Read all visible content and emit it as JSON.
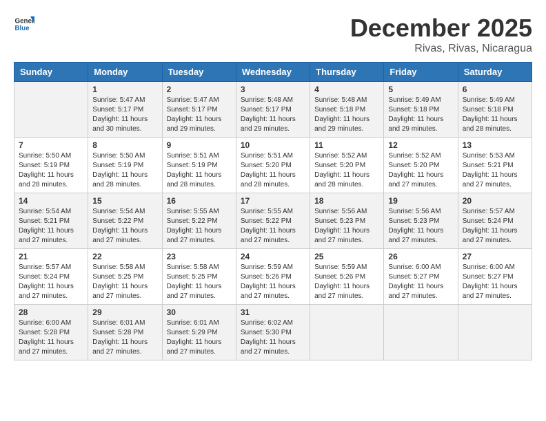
{
  "header": {
    "logo_general": "General",
    "logo_blue": "Blue",
    "month": "December 2025",
    "location": "Rivas, Rivas, Nicaragua"
  },
  "weekdays": [
    "Sunday",
    "Monday",
    "Tuesday",
    "Wednesday",
    "Thursday",
    "Friday",
    "Saturday"
  ],
  "weeks": [
    [
      {
        "day": "",
        "info": ""
      },
      {
        "day": "1",
        "info": "Sunrise: 5:47 AM\nSunset: 5:17 PM\nDaylight: 11 hours\nand 30 minutes."
      },
      {
        "day": "2",
        "info": "Sunrise: 5:47 AM\nSunset: 5:17 PM\nDaylight: 11 hours\nand 29 minutes."
      },
      {
        "day": "3",
        "info": "Sunrise: 5:48 AM\nSunset: 5:17 PM\nDaylight: 11 hours\nand 29 minutes."
      },
      {
        "day": "4",
        "info": "Sunrise: 5:48 AM\nSunset: 5:18 PM\nDaylight: 11 hours\nand 29 minutes."
      },
      {
        "day": "5",
        "info": "Sunrise: 5:49 AM\nSunset: 5:18 PM\nDaylight: 11 hours\nand 29 minutes."
      },
      {
        "day": "6",
        "info": "Sunrise: 5:49 AM\nSunset: 5:18 PM\nDaylight: 11 hours\nand 28 minutes."
      }
    ],
    [
      {
        "day": "7",
        "info": "Sunrise: 5:50 AM\nSunset: 5:19 PM\nDaylight: 11 hours\nand 28 minutes."
      },
      {
        "day": "8",
        "info": "Sunrise: 5:50 AM\nSunset: 5:19 PM\nDaylight: 11 hours\nand 28 minutes."
      },
      {
        "day": "9",
        "info": "Sunrise: 5:51 AM\nSunset: 5:19 PM\nDaylight: 11 hours\nand 28 minutes."
      },
      {
        "day": "10",
        "info": "Sunrise: 5:51 AM\nSunset: 5:20 PM\nDaylight: 11 hours\nand 28 minutes."
      },
      {
        "day": "11",
        "info": "Sunrise: 5:52 AM\nSunset: 5:20 PM\nDaylight: 11 hours\nand 28 minutes."
      },
      {
        "day": "12",
        "info": "Sunrise: 5:52 AM\nSunset: 5:20 PM\nDaylight: 11 hours\nand 27 minutes."
      },
      {
        "day": "13",
        "info": "Sunrise: 5:53 AM\nSunset: 5:21 PM\nDaylight: 11 hours\nand 27 minutes."
      }
    ],
    [
      {
        "day": "14",
        "info": "Sunrise: 5:54 AM\nSunset: 5:21 PM\nDaylight: 11 hours\nand 27 minutes."
      },
      {
        "day": "15",
        "info": "Sunrise: 5:54 AM\nSunset: 5:22 PM\nDaylight: 11 hours\nand 27 minutes."
      },
      {
        "day": "16",
        "info": "Sunrise: 5:55 AM\nSunset: 5:22 PM\nDaylight: 11 hours\nand 27 minutes."
      },
      {
        "day": "17",
        "info": "Sunrise: 5:55 AM\nSunset: 5:22 PM\nDaylight: 11 hours\nand 27 minutes."
      },
      {
        "day": "18",
        "info": "Sunrise: 5:56 AM\nSunset: 5:23 PM\nDaylight: 11 hours\nand 27 minutes."
      },
      {
        "day": "19",
        "info": "Sunrise: 5:56 AM\nSunset: 5:23 PM\nDaylight: 11 hours\nand 27 minutes."
      },
      {
        "day": "20",
        "info": "Sunrise: 5:57 AM\nSunset: 5:24 PM\nDaylight: 11 hours\nand 27 minutes."
      }
    ],
    [
      {
        "day": "21",
        "info": "Sunrise: 5:57 AM\nSunset: 5:24 PM\nDaylight: 11 hours\nand 27 minutes."
      },
      {
        "day": "22",
        "info": "Sunrise: 5:58 AM\nSunset: 5:25 PM\nDaylight: 11 hours\nand 27 minutes."
      },
      {
        "day": "23",
        "info": "Sunrise: 5:58 AM\nSunset: 5:25 PM\nDaylight: 11 hours\nand 27 minutes."
      },
      {
        "day": "24",
        "info": "Sunrise: 5:59 AM\nSunset: 5:26 PM\nDaylight: 11 hours\nand 27 minutes."
      },
      {
        "day": "25",
        "info": "Sunrise: 5:59 AM\nSunset: 5:26 PM\nDaylight: 11 hours\nand 27 minutes."
      },
      {
        "day": "26",
        "info": "Sunrise: 6:00 AM\nSunset: 5:27 PM\nDaylight: 11 hours\nand 27 minutes."
      },
      {
        "day": "27",
        "info": "Sunrise: 6:00 AM\nSunset: 5:27 PM\nDaylight: 11 hours\nand 27 minutes."
      }
    ],
    [
      {
        "day": "28",
        "info": "Sunrise: 6:00 AM\nSunset: 5:28 PM\nDaylight: 11 hours\nand 27 minutes."
      },
      {
        "day": "29",
        "info": "Sunrise: 6:01 AM\nSunset: 5:28 PM\nDaylight: 11 hours\nand 27 minutes."
      },
      {
        "day": "30",
        "info": "Sunrise: 6:01 AM\nSunset: 5:29 PM\nDaylight: 11 hours\nand 27 minutes."
      },
      {
        "day": "31",
        "info": "Sunrise: 6:02 AM\nSunset: 5:30 PM\nDaylight: 11 hours\nand 27 minutes."
      },
      {
        "day": "",
        "info": ""
      },
      {
        "day": "",
        "info": ""
      },
      {
        "day": "",
        "info": ""
      }
    ]
  ]
}
